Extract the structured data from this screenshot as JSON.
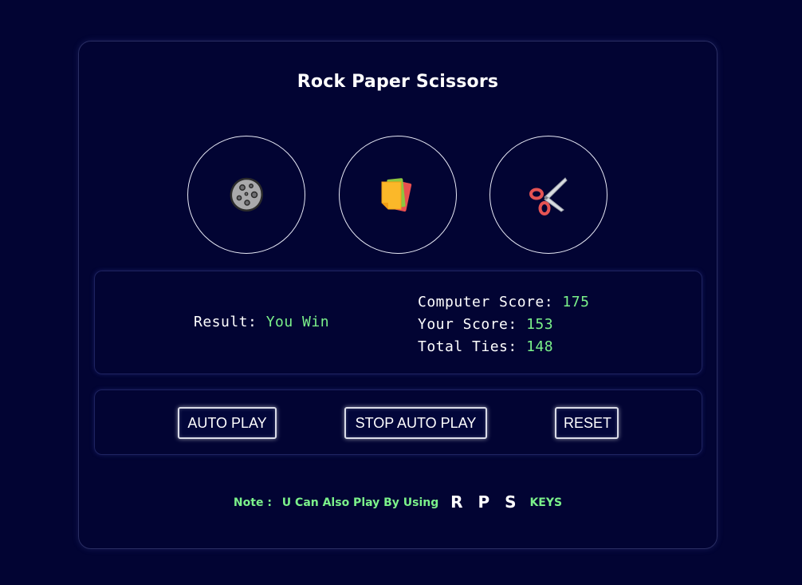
{
  "title": "Rock Paper Scissors",
  "choices": [
    {
      "name": "rock",
      "icon": "rock-icon"
    },
    {
      "name": "paper",
      "icon": "paper-icon"
    },
    {
      "name": "scissors",
      "icon": "scissors-icon"
    }
  ],
  "result": {
    "label": "Result:",
    "value": "You Win"
  },
  "scores": {
    "computer_label": "Computer Score:",
    "computer_value": "175",
    "your_label": "Your Score:",
    "your_value": "153",
    "ties_label": "Total Ties:",
    "ties_value": "148"
  },
  "controls": {
    "auto_play": "AUTO PLAY",
    "stop_auto_play": "STOP AUTO PLAY",
    "reset": "RESET"
  },
  "note": {
    "label": "Note :",
    "text": "U Can Also Play By Using",
    "keys": "R P S",
    "suffix": "KEYS"
  },
  "colors": {
    "background": "#020433",
    "accent_green": "#7bf18a",
    "text": "#ffffff"
  }
}
